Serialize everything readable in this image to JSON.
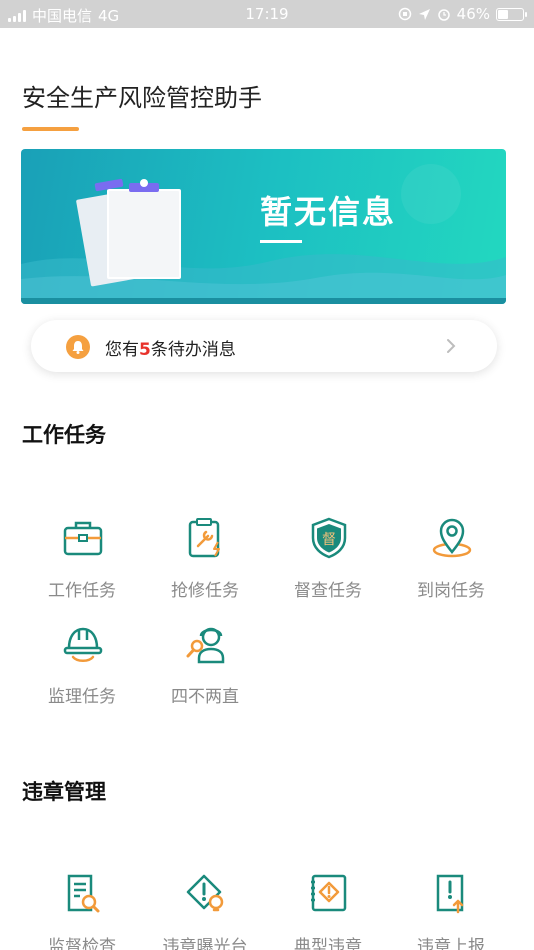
{
  "status_bar": {
    "carrier": "中国电信",
    "network": "4G",
    "time": "17:19",
    "battery": "46%",
    "battery_level": 0.46
  },
  "header": {
    "title": "安全生产风险管控助手"
  },
  "banner": {
    "text": "暂无信息"
  },
  "notice": {
    "prefix": "您有",
    "count": "5",
    "suffix": "条待办消息"
  },
  "sections": {
    "work": {
      "title": "工作任务",
      "items": [
        {
          "label": "工作任务",
          "icon": "toolbox-icon"
        },
        {
          "label": "抢修任务",
          "icon": "repair-clipboard-icon"
        },
        {
          "label": "督查任务",
          "icon": "supervise-shield-icon"
        },
        {
          "label": "到岗任务",
          "icon": "location-pin-icon"
        },
        {
          "label": "监理任务",
          "icon": "hard-hat-icon"
        },
        {
          "label": "四不两直",
          "icon": "inspector-icon"
        }
      ]
    },
    "violation": {
      "title": "违章管理",
      "items": [
        {
          "label": "监督检查",
          "icon": "document-search-icon"
        },
        {
          "label": "违章曝光台",
          "icon": "warning-bulb-icon"
        },
        {
          "label": "典型违章",
          "icon": "typical-violation-icon"
        },
        {
          "label": "违章上报",
          "icon": "report-upload-icon"
        }
      ]
    }
  },
  "colors": {
    "accent_orange": "#f5a040",
    "icon_teal": "#1a8a7c",
    "icon_orange": "#f29a3a",
    "count_red": "#e8322b"
  }
}
